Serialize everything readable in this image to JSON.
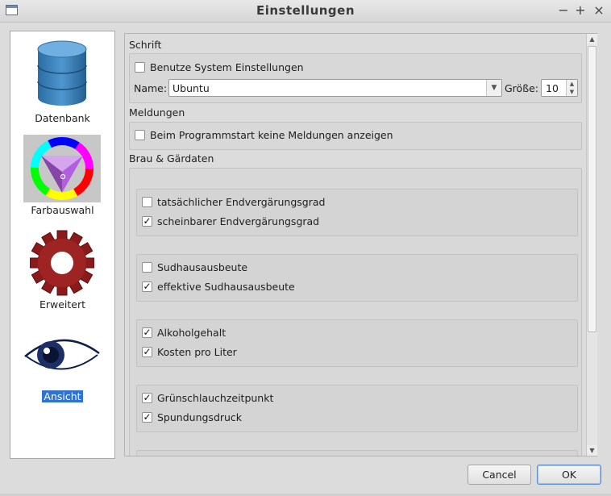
{
  "window": {
    "title": "Einstellungen",
    "controls": {
      "minimize": "−",
      "maximize": "+",
      "close": "×"
    }
  },
  "sidebar": {
    "items": [
      {
        "label": "Datenbank",
        "icon": "database-icon",
        "selected": false
      },
      {
        "label": "Farbauswahl",
        "icon": "color-wheel-icon",
        "selected": false
      },
      {
        "label": "Erweitert",
        "icon": "gear-icon",
        "selected": false
      },
      {
        "label": "Ansicht",
        "icon": "eye-icon",
        "selected": true
      }
    ]
  },
  "content": {
    "schrift": {
      "heading": "Schrift",
      "use_system": {
        "label": "Benutze System Einstellungen",
        "checked": false
      },
      "name_label": "Name:",
      "name_value": "Ubuntu",
      "size_label": "Größe:",
      "size_value": "10"
    },
    "meldungen": {
      "heading": "Meldungen",
      "no_messages": {
        "label": "Beim Programmstart keine Meldungen anzeigen",
        "checked": false
      }
    },
    "braudaten": {
      "heading": "Brau & Gärdaten",
      "groups": [
        [
          {
            "label": "tatsächlicher Endvergärungsgrad",
            "checked": false
          },
          {
            "label": "scheinbarer Endvergärungsgrad",
            "checked": true
          }
        ],
        [
          {
            "label": "Sudhausausbeute",
            "checked": false
          },
          {
            "label": "effektive Sudhausausbeute",
            "checked": true
          }
        ],
        [
          {
            "label": "Alkoholgehalt",
            "checked": true
          },
          {
            "label": "Kosten pro Liter",
            "checked": true
          }
        ],
        [
          {
            "label": "Grünschlauchzeitpunkt",
            "checked": true
          },
          {
            "label": "Spundungsdruck",
            "checked": true
          }
        ]
      ]
    }
  },
  "buttons": {
    "cancel": "Cancel",
    "ok": "OK"
  },
  "colors": {
    "selection": "#3072cf",
    "background": "#dcdcdc"
  },
  "check_glyph": "✓"
}
